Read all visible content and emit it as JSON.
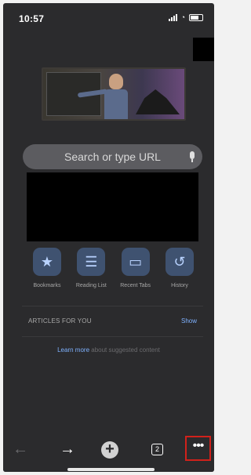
{
  "status": {
    "time": "10:57"
  },
  "search": {
    "placeholder": "Search or type URL"
  },
  "shortcuts": [
    {
      "label": "Bookmarks",
      "icon": "star-icon",
      "glyph": "★"
    },
    {
      "label": "Reading List",
      "icon": "list-icon",
      "glyph": "☰"
    },
    {
      "label": "Recent Tabs",
      "icon": "devices-icon",
      "glyph": "▭"
    },
    {
      "label": "History",
      "icon": "history-icon",
      "glyph": "↺"
    }
  ],
  "articles": {
    "title": "ARTICLES FOR YOU",
    "show_label": "Show"
  },
  "learn_more": {
    "link": "Learn more",
    "rest": " about suggested content"
  },
  "toolbar": {
    "back": "←",
    "forward": "→",
    "new_tab": "+",
    "tab_count": "2",
    "more": "•••"
  },
  "colors": {
    "background": "#2b2b2d",
    "accent": "#7fb2ff",
    "tile": "#3f5270",
    "highlight_border": "#d1211b"
  }
}
